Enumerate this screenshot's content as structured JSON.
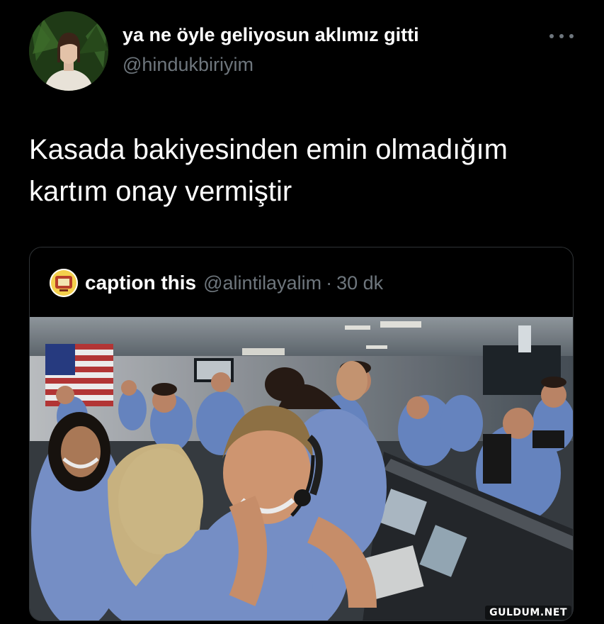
{
  "user": {
    "display_name": "ya ne öyle geliyosun aklımız gitti",
    "handle": "@hindukbiriyim",
    "avatar_icon": "profile-photo"
  },
  "tweet": {
    "text": "Kasada bakiyesinden emin olmadığım kartım onay vermiştir"
  },
  "more_icon": "more-horizontal-icon",
  "quote": {
    "name": "caption this",
    "handle": "@alintilayalim",
    "separator": "·",
    "time": "30 dk",
    "avatar_icon": "caption-this-logo",
    "media_description_icon": "mission-control-celebration-photo"
  },
  "watermark": "GULDUM.NET",
  "colors": {
    "background": "#000000",
    "text_primary": "#ffffff",
    "text_secondary": "#6e767d",
    "card_border": "#2f3336",
    "shirt_blue": "#7f9bd6"
  }
}
